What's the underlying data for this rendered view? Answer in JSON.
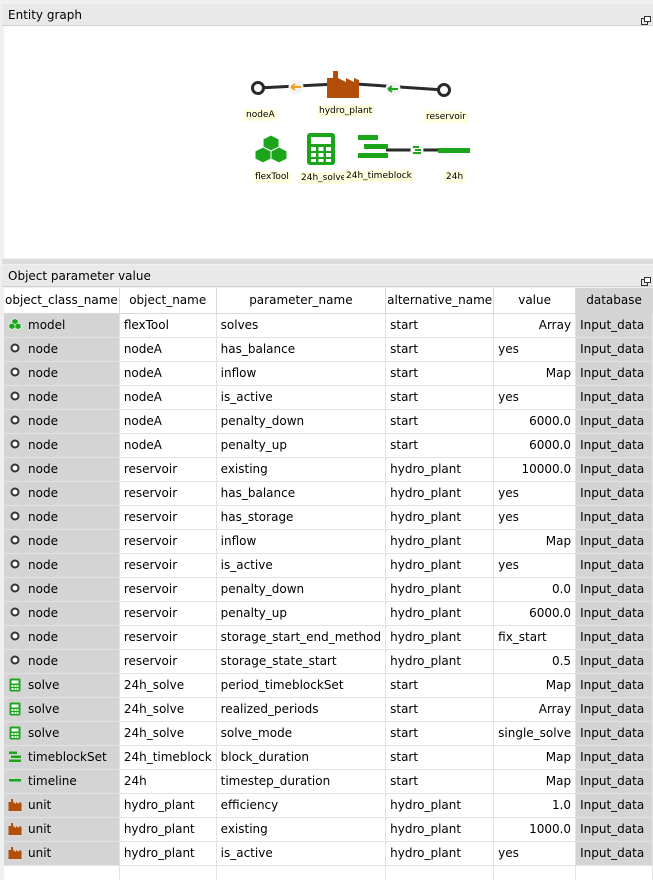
{
  "graph_panel": {
    "title": "Entity graph",
    "nodes": {
      "nodeA": "nodeA",
      "hydro_plant": "hydro_plant",
      "reservoir": "reservoir",
      "flexTool": "flexTool",
      "solve": "24h_solve",
      "timeblock": "24h_timeblock",
      "timeline": "24h"
    }
  },
  "table_panel": {
    "title": "Object parameter value",
    "headers": [
      "object_class_name",
      "object_name",
      "parameter_name",
      "alternative_name",
      "value",
      "database"
    ],
    "rows": [
      {
        "icon": "model",
        "cls": "model",
        "obj": "flexTool",
        "param": "solves",
        "alt": "start",
        "value": "Array",
        "num": true,
        "db": "Input_data"
      },
      {
        "icon": "node",
        "cls": "node",
        "obj": "nodeA",
        "param": "has_balance",
        "alt": "start",
        "value": "yes",
        "num": false,
        "db": "Input_data"
      },
      {
        "icon": "node",
        "cls": "node",
        "obj": "nodeA",
        "param": "inflow",
        "alt": "start",
        "value": "Map",
        "num": true,
        "db": "Input_data"
      },
      {
        "icon": "node",
        "cls": "node",
        "obj": "nodeA",
        "param": "is_active",
        "alt": "start",
        "value": "yes",
        "num": false,
        "db": "Input_data"
      },
      {
        "icon": "node",
        "cls": "node",
        "obj": "nodeA",
        "param": "penalty_down",
        "alt": "start",
        "value": "6000.0",
        "num": true,
        "db": "Input_data"
      },
      {
        "icon": "node",
        "cls": "node",
        "obj": "nodeA",
        "param": "penalty_up",
        "alt": "start",
        "value": "6000.0",
        "num": true,
        "db": "Input_data"
      },
      {
        "icon": "node",
        "cls": "node",
        "obj": "reservoir",
        "param": "existing",
        "alt": "hydro_plant",
        "value": "10000.0",
        "num": true,
        "db": "Input_data"
      },
      {
        "icon": "node",
        "cls": "node",
        "obj": "reservoir",
        "param": "has_balance",
        "alt": "hydro_plant",
        "value": "yes",
        "num": false,
        "db": "Input_data"
      },
      {
        "icon": "node",
        "cls": "node",
        "obj": "reservoir",
        "param": "has_storage",
        "alt": "hydro_plant",
        "value": "yes",
        "num": false,
        "db": "Input_data"
      },
      {
        "icon": "node",
        "cls": "node",
        "obj": "reservoir",
        "param": "inflow",
        "alt": "hydro_plant",
        "value": "Map",
        "num": true,
        "db": "Input_data"
      },
      {
        "icon": "node",
        "cls": "node",
        "obj": "reservoir",
        "param": "is_active",
        "alt": "hydro_plant",
        "value": "yes",
        "num": false,
        "db": "Input_data"
      },
      {
        "icon": "node",
        "cls": "node",
        "obj": "reservoir",
        "param": "penalty_down",
        "alt": "hydro_plant",
        "value": "0.0",
        "num": true,
        "db": "Input_data"
      },
      {
        "icon": "node",
        "cls": "node",
        "obj": "reservoir",
        "param": "penalty_up",
        "alt": "hydro_plant",
        "value": "6000.0",
        "num": true,
        "db": "Input_data"
      },
      {
        "icon": "node",
        "cls": "node",
        "obj": "reservoir",
        "param": "storage_start_end_method",
        "alt": "hydro_plant",
        "value": "fix_start",
        "num": false,
        "db": "Input_data"
      },
      {
        "icon": "node",
        "cls": "node",
        "obj": "reservoir",
        "param": "storage_state_start",
        "alt": "hydro_plant",
        "value": "0.5",
        "num": true,
        "db": "Input_data"
      },
      {
        "icon": "solve",
        "cls": "solve",
        "obj": "24h_solve",
        "param": "period_timeblockSet",
        "alt": "start",
        "value": "Map",
        "num": true,
        "db": "Input_data"
      },
      {
        "icon": "solve",
        "cls": "solve",
        "obj": "24h_solve",
        "param": "realized_periods",
        "alt": "start",
        "value": "Array",
        "num": true,
        "db": "Input_data"
      },
      {
        "icon": "solve",
        "cls": "solve",
        "obj": "24h_solve",
        "param": "solve_mode",
        "alt": "start",
        "value": "single_solve",
        "num": false,
        "db": "Input_data"
      },
      {
        "icon": "timeblockSet",
        "cls": "timeblockSet",
        "obj": "24h_timeblock",
        "param": "block_duration",
        "alt": "start",
        "value": "Map",
        "num": true,
        "db": "Input_data"
      },
      {
        "icon": "timeline",
        "cls": "timeline",
        "obj": "24h",
        "param": "timestep_duration",
        "alt": "start",
        "value": "Map",
        "num": true,
        "db": "Input_data"
      },
      {
        "icon": "unit",
        "cls": "unit",
        "obj": "hydro_plant",
        "param": "efficiency",
        "alt": "hydro_plant",
        "value": "1.0",
        "num": true,
        "db": "Input_data"
      },
      {
        "icon": "unit",
        "cls": "unit",
        "obj": "hydro_plant",
        "param": "existing",
        "alt": "hydro_plant",
        "value": "1000.0",
        "num": true,
        "db": "Input_data"
      },
      {
        "icon": "unit",
        "cls": "unit",
        "obj": "hydro_plant",
        "param": "is_active",
        "alt": "hydro_plant",
        "value": "yes",
        "num": false,
        "db": "Input_data"
      }
    ]
  },
  "colors": {
    "green": "#1aa51a",
    "factory": "#b24e0a",
    "arrow_orange": "#f0a020",
    "selected_gray": "#d4d4d4"
  }
}
